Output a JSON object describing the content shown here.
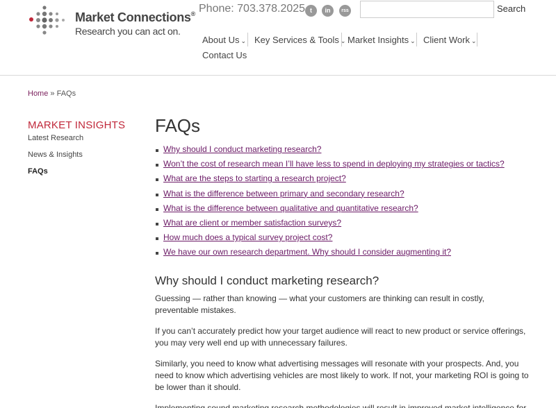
{
  "header": {
    "logo_name": "Market Connections",
    "logo_registered": "®",
    "logo_tagline": "Research you can act on.",
    "phone": "Phone: 703.378.2025",
    "social": [
      {
        "icon": "twitter-icon",
        "glyph": "t"
      },
      {
        "icon": "linkedin-icon",
        "glyph": "in"
      },
      {
        "icon": "rss-icon",
        "glyph": "rss"
      }
    ],
    "search": {
      "placeholder": "",
      "value": "",
      "button_label": "Search"
    },
    "nav": [
      {
        "label": "About Us"
      },
      {
        "label": "Key Services & Tools"
      },
      {
        "label": "Market Insights"
      },
      {
        "label": "Client Work"
      }
    ],
    "nav_contact": "Contact Us",
    "colors": {
      "accent_red": "#c0283a",
      "link_purple": "#6b1a66",
      "logo_gray": "#666666"
    }
  },
  "breadcrumb": {
    "home": "Home",
    "separator": "»",
    "current": "FAQs"
  },
  "sidebar": {
    "title": "MARKET INSIGHTS",
    "items": [
      {
        "label": "Latest Research",
        "active": false
      },
      {
        "label": "News & Insights",
        "active": false
      },
      {
        "label": "FAQs",
        "active": true
      }
    ]
  },
  "main": {
    "title": "FAQs",
    "faq_links": [
      "Why should I conduct marketing research?",
      "Won’t the cost of research mean I’ll have less to spend in deploying my strategies or tactics?",
      "What are the steps to starting a research project?",
      "What is the difference between primary and secondary research?",
      "What is the difference between qualitative and quantitative research?",
      "What are client or member satisfaction surveys?",
      "How much does a typical survey project cost?",
      "We have our own research department. Why should I consider augmenting it?"
    ],
    "section_heading": "Why should I conduct marketing research?",
    "paragraphs": [
      "Guessing — rather than knowing — what your customers are thinking can result in costly, preventable mistakes.",
      "If you can’t accurately predict how your target audience will react to new product or service offerings, you may very well end up with unnecessary failures.",
      "Similarly, you need to know what advertising messages will resonate with your prospects. And, you need to know which advertising vehicles are most likely to work. If not, your marketing ROI is going to be lower than it should.",
      "Implementing sound marketing research methodologies will result in improved market intelligence for"
    ]
  }
}
